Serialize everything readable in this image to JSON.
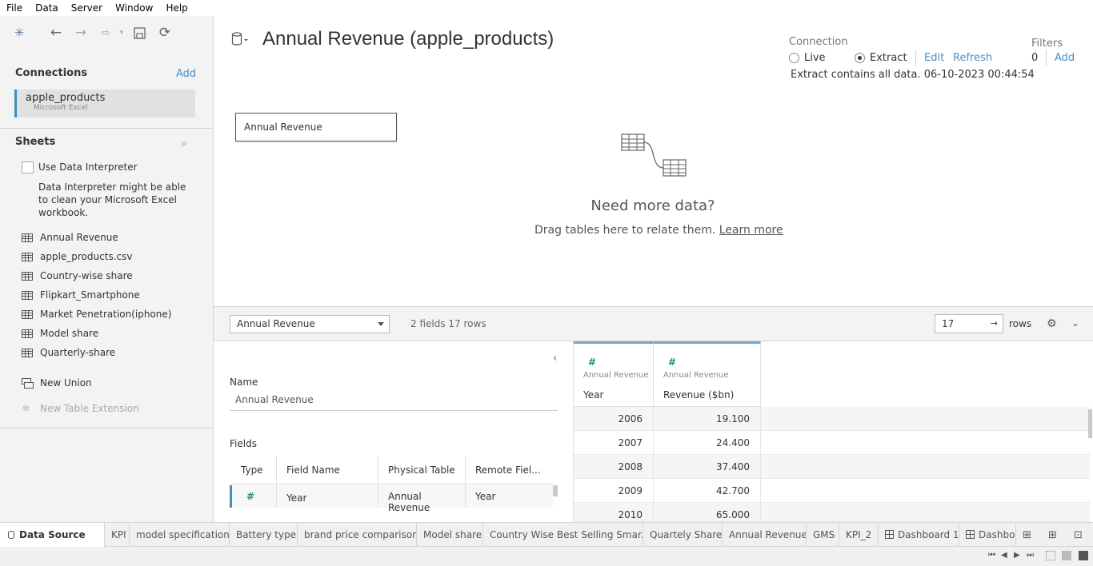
{
  "menu": [
    "File",
    "Data",
    "Server",
    "Window",
    "Help"
  ],
  "toolbar_icons": [
    "tableau-logo-icon",
    "back-arrow-icon",
    "forward-arrow-icon",
    "redo-icon",
    "save-icon",
    "refresh-icon"
  ],
  "sidebar": {
    "connections_title": "Connections",
    "add_label": "Add",
    "connection": {
      "name": "apple_products",
      "type": "Microsoft Excel"
    },
    "sheets_title": "Sheets",
    "use_interpreter_label": "Use Data Interpreter",
    "interpreter_desc": "Data Interpreter might be able to clean your Microsoft Excel workbook.",
    "sheets": [
      "Annual Revenue",
      "apple_products.csv",
      "Country-wise share",
      "Flipkart_Smartphone",
      "Market Penetration(iphone)",
      "Model share",
      "Quarterly-share"
    ],
    "new_union": "New Union",
    "new_table_extension": "New Table Extension"
  },
  "header": {
    "title": "Annual Revenue (apple_products)",
    "connection_label": "Connection",
    "live_label": "Live",
    "extract_label": "Extract",
    "edit_label": "Edit",
    "refresh_label": "Refresh",
    "extract_note": "Extract contains all data. 06-10-2023 00:44:54",
    "filters_label": "Filters",
    "filters_count": "0",
    "filters_add": "Add"
  },
  "canvas": {
    "table_name": "Annual Revenue",
    "need_more": "Need more data?",
    "drag_text": "Drag tables here to relate them.",
    "learn_more": "Learn more"
  },
  "grid_bar": {
    "selected_table": "Annual Revenue",
    "meta": "2 fields 17 rows",
    "rows_value": "17",
    "rows_label": "rows"
  },
  "details": {
    "name_label": "Name",
    "name_value": "Annual Revenue",
    "fields_label": "Fields",
    "columns": [
      "Type",
      "Field Name",
      "Physical Table",
      "Remote Fiel..."
    ],
    "row": {
      "type": "#",
      "field_name": "Year",
      "physical_table": "Annual Revenue",
      "remote_field": "Year"
    }
  },
  "data_grid": {
    "columns": [
      {
        "type": "#",
        "source": "Annual Revenue",
        "name": "Year"
      },
      {
        "type": "#",
        "source": "Annual Revenue",
        "name": "Revenue ($bn)"
      }
    ],
    "rows": [
      [
        "2006",
        "19.100"
      ],
      [
        "2007",
        "24.400"
      ],
      [
        "2008",
        "37.400"
      ],
      [
        "2009",
        "42.700"
      ],
      [
        "2010",
        "65.000"
      ]
    ]
  },
  "tabs": [
    {
      "label": "Data Source",
      "active": true,
      "icon": "data-source-icon"
    },
    {
      "label": "KPI"
    },
    {
      "label": "model specification"
    },
    {
      "label": "Battery type"
    },
    {
      "label": "brand price comparison"
    },
    {
      "label": "Model share"
    },
    {
      "label": "Country Wise Best Selling Smar..."
    },
    {
      "label": "Quartely Share"
    },
    {
      "label": "Annual Revenue"
    },
    {
      "label": "GMS"
    },
    {
      "label": "KPI_2"
    },
    {
      "label": "Dashboard 1",
      "icon": "dashboard-icon"
    },
    {
      "label": "Dashboa",
      "icon": "dashboard-icon"
    }
  ],
  "colors": {
    "accent": "#4b8fc7",
    "numeric_type": "#1e8f85",
    "active_connection_bar": "#3e8fb9"
  }
}
